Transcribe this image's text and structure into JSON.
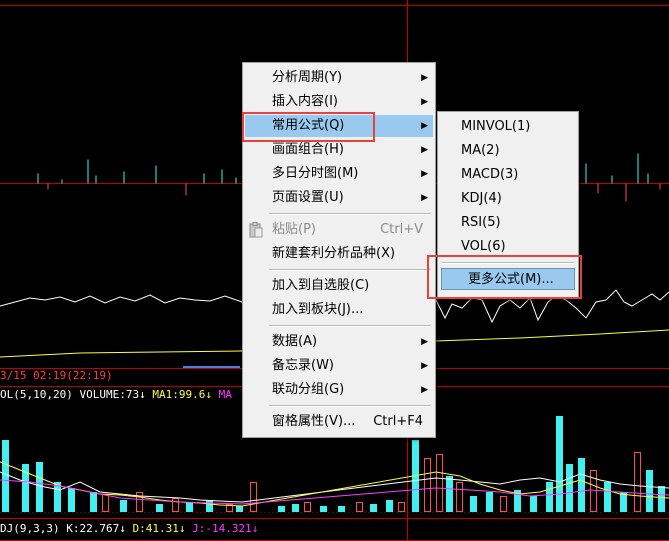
{
  "colors": {
    "background": "#000000",
    "grid_red": "#c00000",
    "menu_bg": "#f0f0f0",
    "highlight": "#99c9ef",
    "annotation": "#e8423c",
    "cyan": "#41f1f1",
    "yellow": "#ffff3c",
    "magenta": "#ff3cff",
    "white": "#ffffff"
  },
  "status": {
    "time_text": "3/15 02:19(22:19)",
    "volume": {
      "name": "OL(5,10,20)",
      "volume_label": "VOLUME:73",
      "ma1_label": "MA1:99.6",
      "ma2_label": "MA"
    },
    "kdj": {
      "name": "DJ(9,3,3)",
      "k_label": "K:22.767",
      "d_label": "D:41.31",
      "j_label": "J:-14.321"
    }
  },
  "context_menu": {
    "items": [
      {
        "label": "分析周期(Y)",
        "submenu": true
      },
      {
        "label": "插入内容(I)",
        "submenu": true
      },
      {
        "label": "常用公式(Q)",
        "submenu": true,
        "highlighted": true
      },
      {
        "label": "画面组合(H)",
        "submenu": true
      },
      {
        "label": "多日分时图(M)",
        "submenu": true
      },
      {
        "label": "页面设置(U)",
        "submenu": true
      },
      {
        "label": "粘贴(P)",
        "shortcut": "Ctrl+V",
        "disabled": true,
        "icon": "clipboard-icon"
      },
      {
        "label": "新建套利分析品种(X)"
      },
      {
        "label": "加入到自选股(C)"
      },
      {
        "label": "加入到板块(J)..."
      },
      {
        "label": "数据(A)",
        "submenu": true
      },
      {
        "label": "备忘录(W)",
        "submenu": true
      },
      {
        "label": "联动分组(G)",
        "submenu": true
      },
      {
        "label": "窗格属性(V)...",
        "shortcut": "Ctrl+F4"
      }
    ]
  },
  "formula_submenu": {
    "items": [
      {
        "label": "MINVOL(1)"
      },
      {
        "label": "MA(2)"
      },
      {
        "label": "MACD(3)"
      },
      {
        "label": "KDJ(4)"
      },
      {
        "label": "RSI(5)"
      },
      {
        "label": "VOL(6)"
      },
      {
        "label": "更多公式(M)...",
        "highlighted": true
      }
    ]
  }
}
